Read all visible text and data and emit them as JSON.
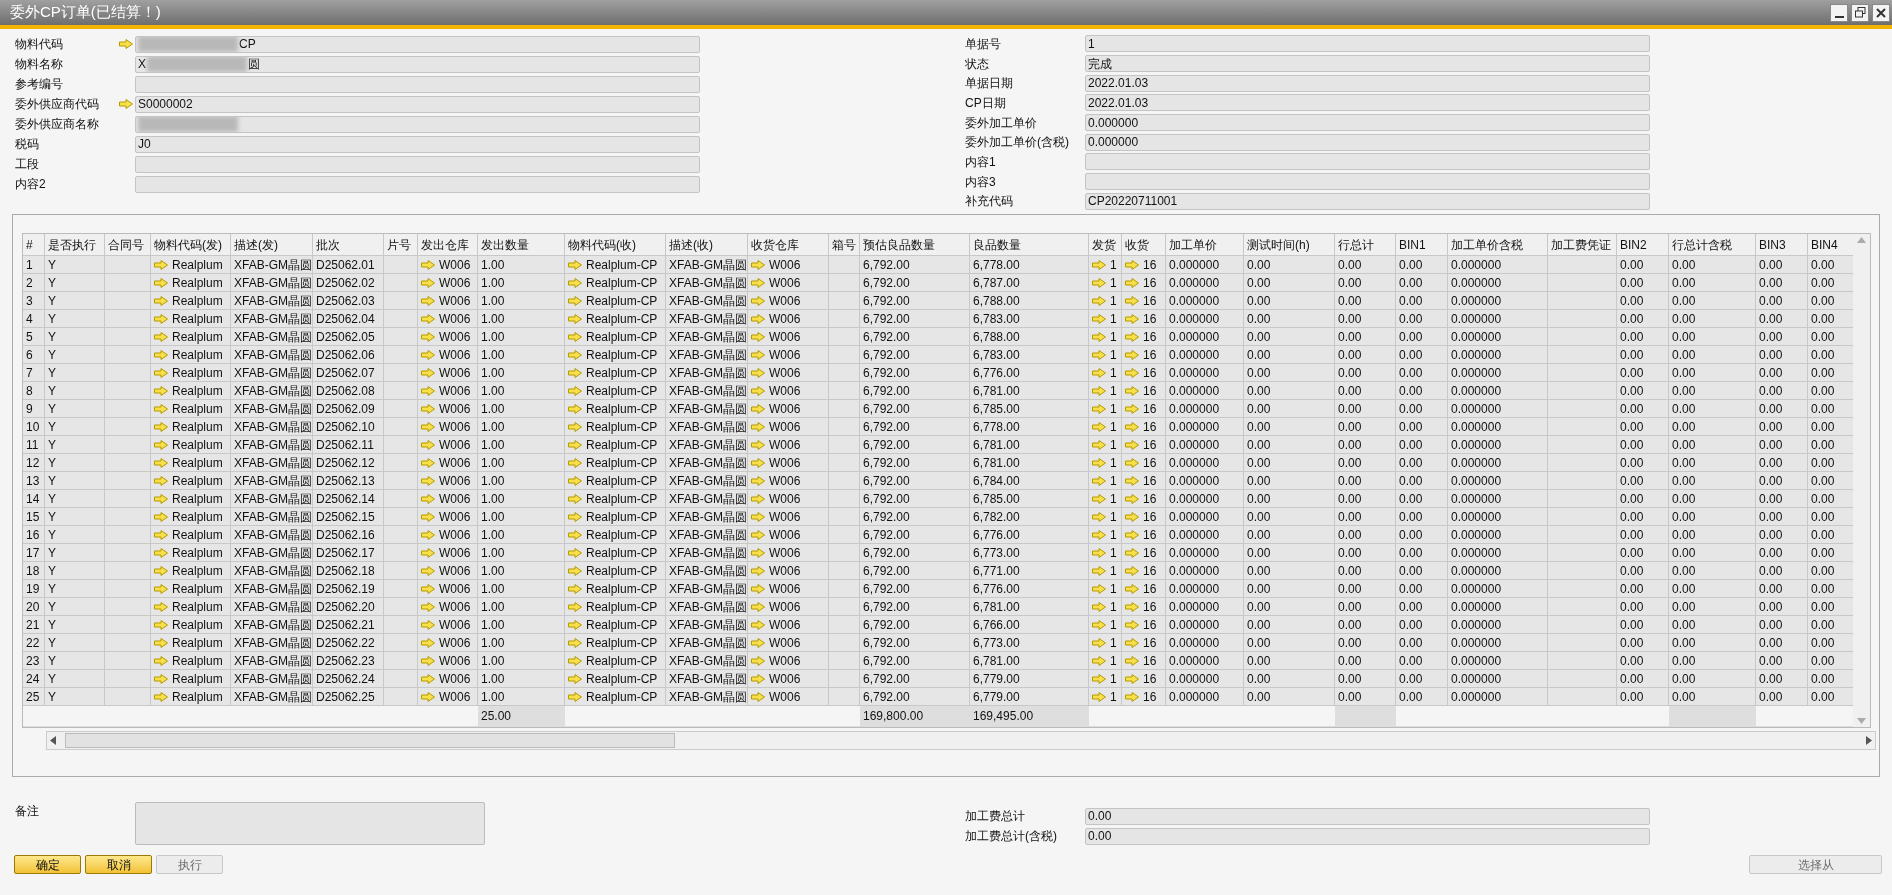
{
  "window": {
    "title": "委外CP订单(已结算！)"
  },
  "left_fields": [
    {
      "label": "物料代码",
      "link": true,
      "redacted": true,
      "value": "CP"
    },
    {
      "label": "物料名称",
      "value_before": "X",
      "redacted": true,
      "value": "圆"
    },
    {
      "label": "参考编号"
    },
    {
      "label": "委外供应商代码",
      "link": true,
      "value": "S0000002"
    },
    {
      "label": "委外供应商名称",
      "redacted": true
    },
    {
      "label": "税码",
      "value": "J0"
    },
    {
      "label": "工段"
    },
    {
      "label": "内容2"
    }
  ],
  "right_fields": [
    {
      "label": "单据号",
      "value": "1"
    },
    {
      "label": "状态",
      "value": "完成"
    },
    {
      "label": "单据日期",
      "value": "2022.01.03"
    },
    {
      "label": "CP日期",
      "value": "2022.01.03"
    },
    {
      "label": "委外加工单价",
      "value": "0.000000"
    },
    {
      "label": "委外加工单价(含税)",
      "value": "0.000000"
    },
    {
      "label": "内容1"
    },
    {
      "label": "内容3"
    },
    {
      "label": "补充代码",
      "value": "CP20220711001"
    }
  ],
  "table": {
    "columns": [
      {
        "label": "#"
      },
      {
        "label": "是否执行"
      },
      {
        "label": "合同号"
      },
      {
        "label": "物料代码(发)",
        "link": true
      },
      {
        "label": "描述(发)"
      },
      {
        "label": "批次"
      },
      {
        "label": "片号"
      },
      {
        "label": "发出仓库",
        "link": true
      },
      {
        "label": "发出数量",
        "total": "25.00",
        "total_box": true
      },
      {
        "label": "物料代码(收)",
        "link": true
      },
      {
        "label": "描述(收)"
      },
      {
        "label": "收货仓库",
        "link": true
      },
      {
        "label": "箱号"
      },
      {
        "label": "预估良品数量",
        "total": "169,800.00",
        "total_box": true
      },
      {
        "label": "良品数量",
        "total": "169,495.00",
        "total_box": true
      },
      {
        "label": "发货",
        "link": true
      },
      {
        "label": "收货",
        "link": true
      },
      {
        "label": "加工单价"
      },
      {
        "label": "测试时间(h)"
      },
      {
        "label": "行总计",
        "total_box": true
      },
      {
        "label": "BIN1"
      },
      {
        "label": "加工单价含税"
      },
      {
        "label": "加工费凭证"
      },
      {
        "label": "BIN2"
      },
      {
        "label": "行总计含税",
        "total_box": true
      },
      {
        "label": "BIN3"
      },
      {
        "label": "BIN4"
      }
    ],
    "rows": [
      [
        "1",
        "Y",
        null,
        "Realplum",
        "XFAB-GM晶圆",
        "D25062.01",
        null,
        "W006",
        "1.00",
        "Realplum-CP",
        "XFAB-GM晶圆",
        "W006",
        null,
        "6,792.00",
        "6,778.00",
        "1",
        "16",
        "0.000000",
        "0.00",
        "0.00",
        "0.00",
        "0.000000",
        null,
        "0.00",
        "0.00",
        "0.00",
        "0.00"
      ],
      [
        "2",
        "Y",
        null,
        "Realplum",
        "XFAB-GM晶圆",
        "D25062.02",
        null,
        "W006",
        "1.00",
        "Realplum-CP",
        "XFAB-GM晶圆",
        "W006",
        null,
        "6,792.00",
        "6,787.00",
        "1",
        "16",
        "0.000000",
        "0.00",
        "0.00",
        "0.00",
        "0.000000",
        null,
        "0.00",
        "0.00",
        "0.00",
        "0.00"
      ],
      [
        "3",
        "Y",
        null,
        "Realplum",
        "XFAB-GM晶圆",
        "D25062.03",
        null,
        "W006",
        "1.00",
        "Realplum-CP",
        "XFAB-GM晶圆",
        "W006",
        null,
        "6,792.00",
        "6,788.00",
        "1",
        "16",
        "0.000000",
        "0.00",
        "0.00",
        "0.00",
        "0.000000",
        null,
        "0.00",
        "0.00",
        "0.00",
        "0.00"
      ],
      [
        "4",
        "Y",
        null,
        "Realplum",
        "XFAB-GM晶圆",
        "D25062.04",
        null,
        "W006",
        "1.00",
        "Realplum-CP",
        "XFAB-GM晶圆",
        "W006",
        null,
        "6,792.00",
        "6,783.00",
        "1",
        "16",
        "0.000000",
        "0.00",
        "0.00",
        "0.00",
        "0.000000",
        null,
        "0.00",
        "0.00",
        "0.00",
        "0.00"
      ],
      [
        "5",
        "Y",
        null,
        "Realplum",
        "XFAB-GM晶圆",
        "D25062.05",
        null,
        "W006",
        "1.00",
        "Realplum-CP",
        "XFAB-GM晶圆",
        "W006",
        null,
        "6,792.00",
        "6,788.00",
        "1",
        "16",
        "0.000000",
        "0.00",
        "0.00",
        "0.00",
        "0.000000",
        null,
        "0.00",
        "0.00",
        "0.00",
        "0.00"
      ],
      [
        "6",
        "Y",
        null,
        "Realplum",
        "XFAB-GM晶圆",
        "D25062.06",
        null,
        "W006",
        "1.00",
        "Realplum-CP",
        "XFAB-GM晶圆",
        "W006",
        null,
        "6,792.00",
        "6,783.00",
        "1",
        "16",
        "0.000000",
        "0.00",
        "0.00",
        "0.00",
        "0.000000",
        null,
        "0.00",
        "0.00",
        "0.00",
        "0.00"
      ],
      [
        "7",
        "Y",
        null,
        "Realplum",
        "XFAB-GM晶圆",
        "D25062.07",
        null,
        "W006",
        "1.00",
        "Realplum-CP",
        "XFAB-GM晶圆",
        "W006",
        null,
        "6,792.00",
        "6,776.00",
        "1",
        "16",
        "0.000000",
        "0.00",
        "0.00",
        "0.00",
        "0.000000",
        null,
        "0.00",
        "0.00",
        "0.00",
        "0.00"
      ],
      [
        "8",
        "Y",
        null,
        "Realplum",
        "XFAB-GM晶圆",
        "D25062.08",
        null,
        "W006",
        "1.00",
        "Realplum-CP",
        "XFAB-GM晶圆",
        "W006",
        null,
        "6,792.00",
        "6,781.00",
        "1",
        "16",
        "0.000000",
        "0.00",
        "0.00",
        "0.00",
        "0.000000",
        null,
        "0.00",
        "0.00",
        "0.00",
        "0.00"
      ],
      [
        "9",
        "Y",
        null,
        "Realplum",
        "XFAB-GM晶圆",
        "D25062.09",
        null,
        "W006",
        "1.00",
        "Realplum-CP",
        "XFAB-GM晶圆",
        "W006",
        null,
        "6,792.00",
        "6,785.00",
        "1",
        "16",
        "0.000000",
        "0.00",
        "0.00",
        "0.00",
        "0.000000",
        null,
        "0.00",
        "0.00",
        "0.00",
        "0.00"
      ],
      [
        "10",
        "Y",
        null,
        "Realplum",
        "XFAB-GM晶圆",
        "D25062.10",
        null,
        "W006",
        "1.00",
        "Realplum-CP",
        "XFAB-GM晶圆",
        "W006",
        null,
        "6,792.00",
        "6,778.00",
        "1",
        "16",
        "0.000000",
        "0.00",
        "0.00",
        "0.00",
        "0.000000",
        null,
        "0.00",
        "0.00",
        "0.00",
        "0.00"
      ],
      [
        "11",
        "Y",
        null,
        "Realplum",
        "XFAB-GM晶圆",
        "D25062.11",
        null,
        "W006",
        "1.00",
        "Realplum-CP",
        "XFAB-GM晶圆",
        "W006",
        null,
        "6,792.00",
        "6,781.00",
        "1",
        "16",
        "0.000000",
        "0.00",
        "0.00",
        "0.00",
        "0.000000",
        null,
        "0.00",
        "0.00",
        "0.00",
        "0.00"
      ],
      [
        "12",
        "Y",
        null,
        "Realplum",
        "XFAB-GM晶圆",
        "D25062.12",
        null,
        "W006",
        "1.00",
        "Realplum-CP",
        "XFAB-GM晶圆",
        "W006",
        null,
        "6,792.00",
        "6,781.00",
        "1",
        "16",
        "0.000000",
        "0.00",
        "0.00",
        "0.00",
        "0.000000",
        null,
        "0.00",
        "0.00",
        "0.00",
        "0.00"
      ],
      [
        "13",
        "Y",
        null,
        "Realplum",
        "XFAB-GM晶圆",
        "D25062.13",
        null,
        "W006",
        "1.00",
        "Realplum-CP",
        "XFAB-GM晶圆",
        "W006",
        null,
        "6,792.00",
        "6,784.00",
        "1",
        "16",
        "0.000000",
        "0.00",
        "0.00",
        "0.00",
        "0.000000",
        null,
        "0.00",
        "0.00",
        "0.00",
        "0.00"
      ],
      [
        "14",
        "Y",
        null,
        "Realplum",
        "XFAB-GM晶圆",
        "D25062.14",
        null,
        "W006",
        "1.00",
        "Realplum-CP",
        "XFAB-GM晶圆",
        "W006",
        null,
        "6,792.00",
        "6,785.00",
        "1",
        "16",
        "0.000000",
        "0.00",
        "0.00",
        "0.00",
        "0.000000",
        null,
        "0.00",
        "0.00",
        "0.00",
        "0.00"
      ],
      [
        "15",
        "Y",
        null,
        "Realplum",
        "XFAB-GM晶圆",
        "D25062.15",
        null,
        "W006",
        "1.00",
        "Realplum-CP",
        "XFAB-GM晶圆",
        "W006",
        null,
        "6,792.00",
        "6,782.00",
        "1",
        "16",
        "0.000000",
        "0.00",
        "0.00",
        "0.00",
        "0.000000",
        null,
        "0.00",
        "0.00",
        "0.00",
        "0.00"
      ],
      [
        "16",
        "Y",
        null,
        "Realplum",
        "XFAB-GM晶圆",
        "D25062.16",
        null,
        "W006",
        "1.00",
        "Realplum-CP",
        "XFAB-GM晶圆",
        "W006",
        null,
        "6,792.00",
        "6,776.00",
        "1",
        "16",
        "0.000000",
        "0.00",
        "0.00",
        "0.00",
        "0.000000",
        null,
        "0.00",
        "0.00",
        "0.00",
        "0.00"
      ],
      [
        "17",
        "Y",
        null,
        "Realplum",
        "XFAB-GM晶圆",
        "D25062.17",
        null,
        "W006",
        "1.00",
        "Realplum-CP",
        "XFAB-GM晶圆",
        "W006",
        null,
        "6,792.00",
        "6,773.00",
        "1",
        "16",
        "0.000000",
        "0.00",
        "0.00",
        "0.00",
        "0.000000",
        null,
        "0.00",
        "0.00",
        "0.00",
        "0.00"
      ],
      [
        "18",
        "Y",
        null,
        "Realplum",
        "XFAB-GM晶圆",
        "D25062.18",
        null,
        "W006",
        "1.00",
        "Realplum-CP",
        "XFAB-GM晶圆",
        "W006",
        null,
        "6,792.00",
        "6,771.00",
        "1",
        "16",
        "0.000000",
        "0.00",
        "0.00",
        "0.00",
        "0.000000",
        null,
        "0.00",
        "0.00",
        "0.00",
        "0.00"
      ],
      [
        "19",
        "Y",
        null,
        "Realplum",
        "XFAB-GM晶圆",
        "D25062.19",
        null,
        "W006",
        "1.00",
        "Realplum-CP",
        "XFAB-GM晶圆",
        "W006",
        null,
        "6,792.00",
        "6,776.00",
        "1",
        "16",
        "0.000000",
        "0.00",
        "0.00",
        "0.00",
        "0.000000",
        null,
        "0.00",
        "0.00",
        "0.00",
        "0.00"
      ],
      [
        "20",
        "Y",
        null,
        "Realplum",
        "XFAB-GM晶圆",
        "D25062.20",
        null,
        "W006",
        "1.00",
        "Realplum-CP",
        "XFAB-GM晶圆",
        "W006",
        null,
        "6,792.00",
        "6,781.00",
        "1",
        "16",
        "0.000000",
        "0.00",
        "0.00",
        "0.00",
        "0.000000",
        null,
        "0.00",
        "0.00",
        "0.00",
        "0.00"
      ],
      [
        "21",
        "Y",
        null,
        "Realplum",
        "XFAB-GM晶圆",
        "D25062.21",
        null,
        "W006",
        "1.00",
        "Realplum-CP",
        "XFAB-GM晶圆",
        "W006",
        null,
        "6,792.00",
        "6,766.00",
        "1",
        "16",
        "0.000000",
        "0.00",
        "0.00",
        "0.00",
        "0.000000",
        null,
        "0.00",
        "0.00",
        "0.00",
        "0.00"
      ],
      [
        "22",
        "Y",
        null,
        "Realplum",
        "XFAB-GM晶圆",
        "D25062.22",
        null,
        "W006",
        "1.00",
        "Realplum-CP",
        "XFAB-GM晶圆",
        "W006",
        null,
        "6,792.00",
        "6,773.00",
        "1",
        "16",
        "0.000000",
        "0.00",
        "0.00",
        "0.00",
        "0.000000",
        null,
        "0.00",
        "0.00",
        "0.00",
        "0.00"
      ],
      [
        "23",
        "Y",
        null,
        "Realplum",
        "XFAB-GM晶圆",
        "D25062.23",
        null,
        "W006",
        "1.00",
        "Realplum-CP",
        "XFAB-GM晶圆",
        "W006",
        null,
        "6,792.00",
        "6,781.00",
        "1",
        "16",
        "0.000000",
        "0.00",
        "0.00",
        "0.00",
        "0.000000",
        null,
        "0.00",
        "0.00",
        "0.00",
        "0.00"
      ],
      [
        "24",
        "Y",
        null,
        "Realplum",
        "XFAB-GM晶圆",
        "D25062.24",
        null,
        "W006",
        "1.00",
        "Realplum-CP",
        "XFAB-GM晶圆",
        "W006",
        null,
        "6,792.00",
        "6,779.00",
        "1",
        "16",
        "0.000000",
        "0.00",
        "0.00",
        "0.00",
        "0.000000",
        null,
        "0.00",
        "0.00",
        "0.00",
        "0.00"
      ],
      [
        "25",
        "Y",
        null,
        "Realplum",
        "XFAB-GM晶圆",
        "D25062.25",
        null,
        "W006",
        "1.00",
        "Realplum-CP",
        "XFAB-GM晶圆",
        "W006",
        null,
        "6,792.00",
        "6,779.00",
        "1",
        "16",
        "0.000000",
        "0.00",
        "0.00",
        "0.00",
        "0.000000",
        null,
        "0.00",
        "0.00",
        "0.00",
        "0.00"
      ]
    ]
  },
  "remarks": {
    "label": "备注"
  },
  "summary_fields": [
    {
      "label": "加工费总计",
      "value": "0.00"
    },
    {
      "label": "加工费总计(含税)",
      "value": "0.00"
    }
  ],
  "buttons": [
    {
      "label": "确定",
      "disabled": false
    },
    {
      "label": "取消",
      "disabled": false
    },
    {
      "label": "执行",
      "disabled": true
    }
  ],
  "right_button": {
    "label": "选择从",
    "disabled": true
  }
}
